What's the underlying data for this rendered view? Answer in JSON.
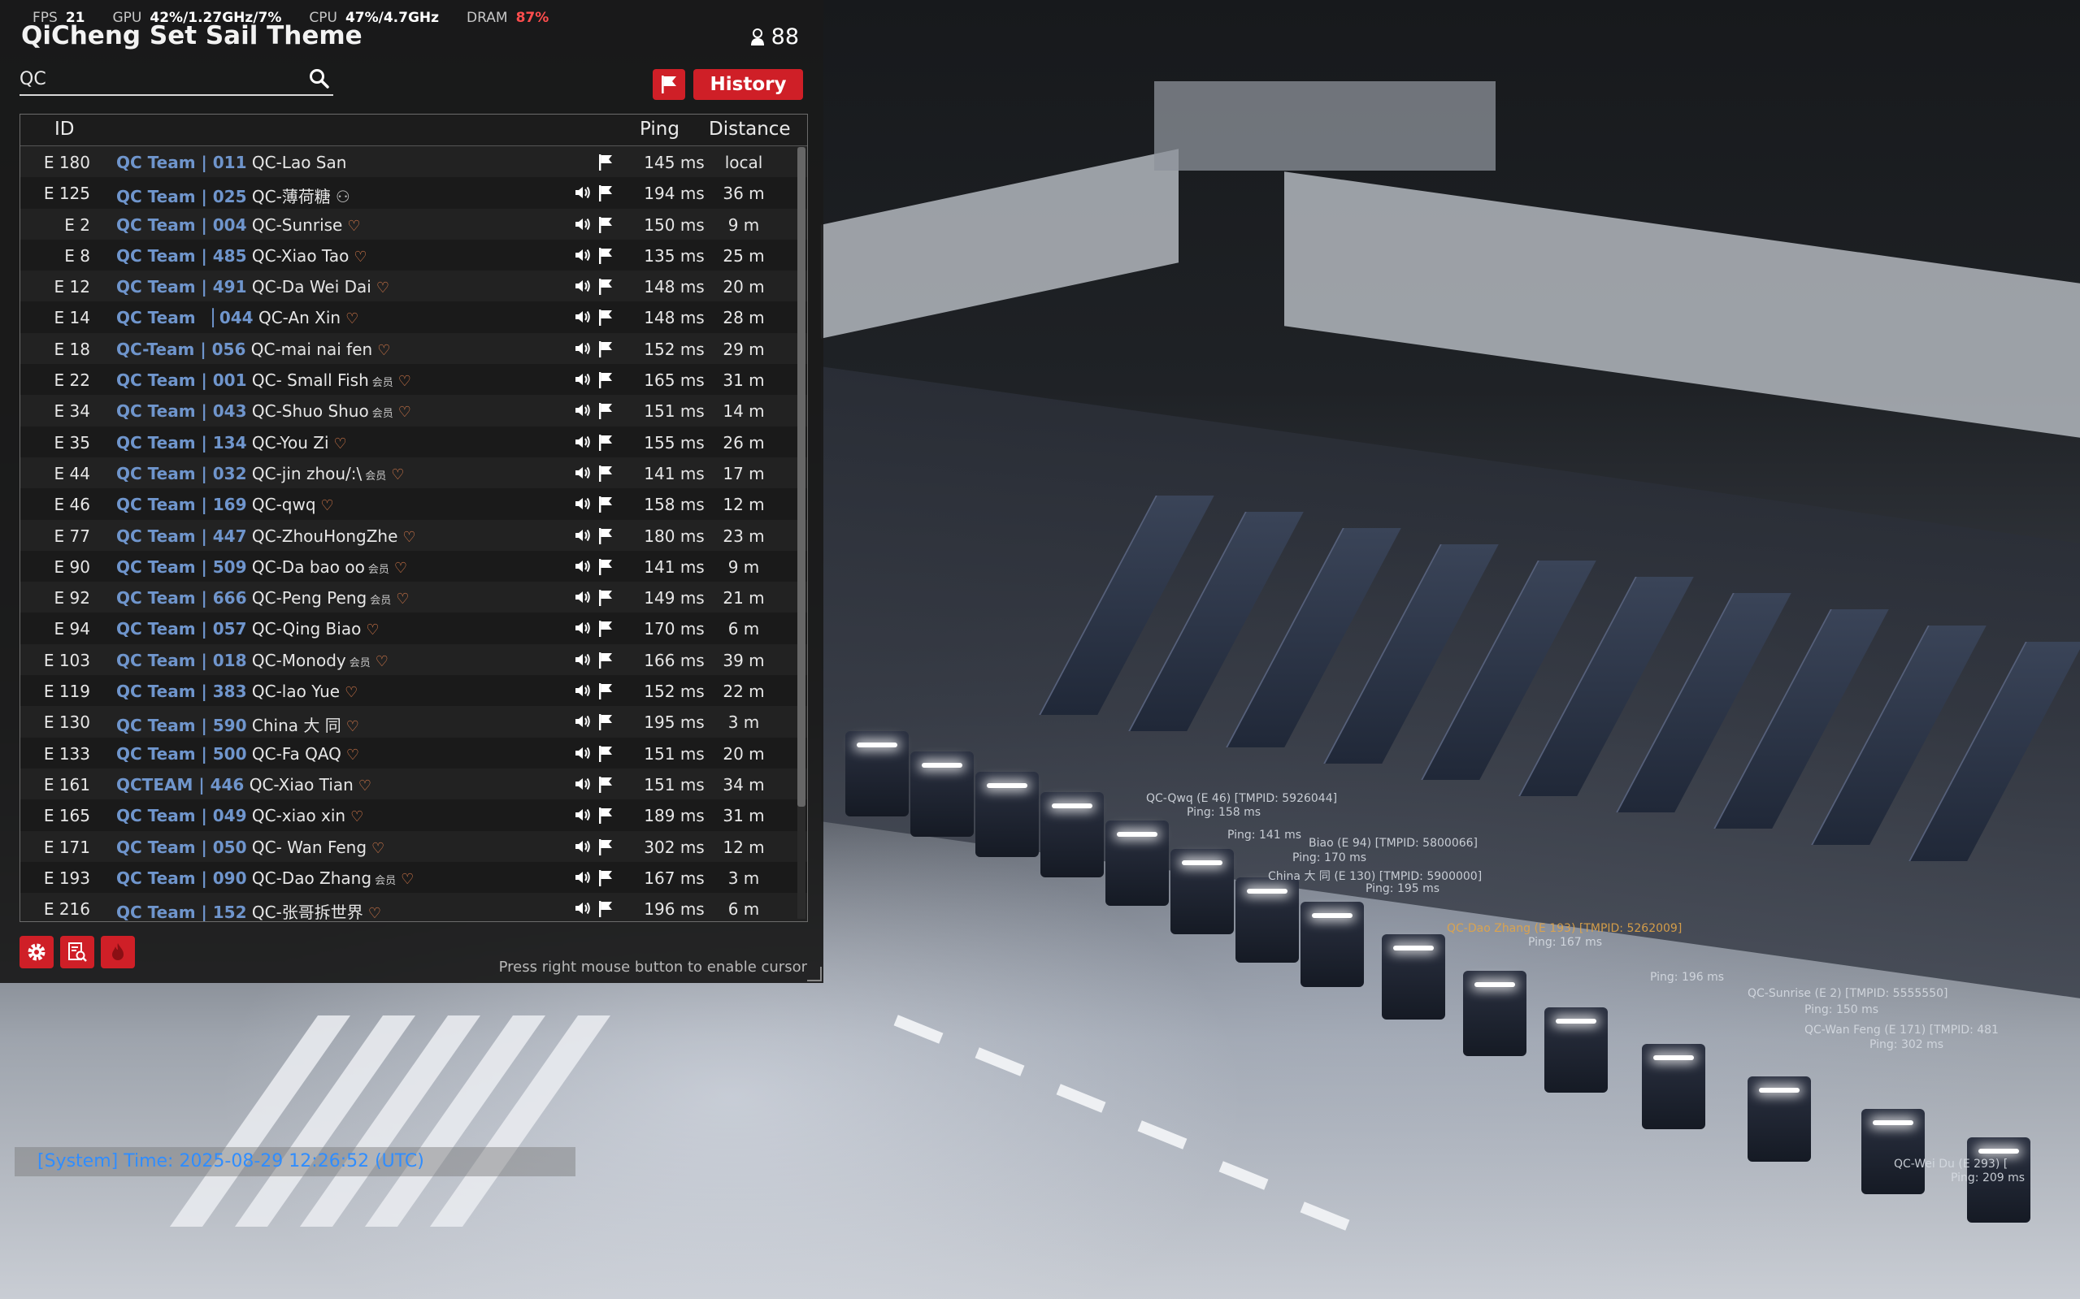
{
  "hud": {
    "fps_label": "FPS",
    "fps": "21",
    "gpu_label": "GPU",
    "gpu": "42%/1.27GHz/7%",
    "cpu_label": "CPU",
    "cpu": "47%/4.7GHz",
    "dram_label": "DRAM",
    "dram": "87%"
  },
  "panel": {
    "title": "QiCheng Set Sail Theme",
    "player_count": "88",
    "search_value": "QC",
    "history_label": "History",
    "hint": "Press right mouse button to enable cursor"
  },
  "table": {
    "headers": {
      "id": "ID",
      "ping": "Ping",
      "distance": "Distance"
    },
    "rows": [
      {
        "id": "E 180",
        "team": "QC Team | 011",
        "name": "QC-Lao San",
        "extra": "",
        "speaker": false,
        "ping": "145 ms",
        "dist": "local"
      },
      {
        "id": "E 125",
        "team": "QC Team | 025",
        "name": "QC-薄荷糖",
        "extra": "person",
        "speaker": true,
        "ping": "194 ms",
        "dist": "36 m"
      },
      {
        "id": "E 2",
        "team": "QC Team | 004",
        "name": "QC-Sunrise",
        "extra": "heart",
        "speaker": true,
        "ping": "150 ms",
        "dist": "9 m"
      },
      {
        "id": "E 8",
        "team": "QC Team | 485",
        "name": "QC-Xiao Tao",
        "extra": "heart",
        "speaker": true,
        "ping": "135 ms",
        "dist": "25 m"
      },
      {
        "id": "E 12",
        "team": "QC Team | 491",
        "name": "QC-Da Wei Dai",
        "extra": "heart",
        "speaker": true,
        "ping": "148 ms",
        "dist": "20 m"
      },
      {
        "id": "E 14",
        "team": "QC Team ▕ 044",
        "name": "QC-An Xin",
        "extra": "heart",
        "speaker": true,
        "ping": "148 ms",
        "dist": "28 m"
      },
      {
        "id": "E 18",
        "team": "QC-Team | 056",
        "name": "QC-mai nai fen",
        "extra": "heart",
        "speaker": true,
        "ping": "152 ms",
        "dist": "29 m"
      },
      {
        "id": "E 22",
        "team": "QC Team | 001",
        "name": "QC- Small Fish",
        "extra": "member-heart",
        "speaker": true,
        "ping": "165 ms",
        "dist": "31 m"
      },
      {
        "id": "E 34",
        "team": "QC Team | 043",
        "name": "QC-Shuo Shuo",
        "extra": "member-heart",
        "speaker": true,
        "ping": "151 ms",
        "dist": "14 m"
      },
      {
        "id": "E 35",
        "team": "QC Team | 134",
        "name": "QC-You Zi",
        "extra": "heart",
        "speaker": true,
        "ping": "155 ms",
        "dist": "26 m"
      },
      {
        "id": "E 44",
        "team": "QC Team | 032",
        "name": "QC-jin zhou/:\\",
        "extra": "member-heart",
        "speaker": true,
        "ping": "141 ms",
        "dist": "17 m"
      },
      {
        "id": "E 46",
        "team": "QC Team | 169",
        "name": "QC-qwq",
        "extra": "heart",
        "speaker": true,
        "ping": "158 ms",
        "dist": "12 m"
      },
      {
        "id": "E 77",
        "team": "QC Team | 447",
        "name": "QC-ZhouHongZhe",
        "extra": "heart",
        "speaker": true,
        "ping": "180 ms",
        "dist": "23 m"
      },
      {
        "id": "E 90",
        "team": "QC Team | 509",
        "name": "QC-Da bao oo",
        "extra": "member-heart",
        "speaker": true,
        "ping": "141 ms",
        "dist": "9 m"
      },
      {
        "id": "E 92",
        "team": "QC Team | 666",
        "name": " QC-Peng Peng",
        "extra": "member-heart",
        "speaker": true,
        "ping": "149 ms",
        "dist": "21 m"
      },
      {
        "id": "E 94",
        "team": "QC Team | 057",
        "name": "QC-Qing Biao",
        "extra": "heart",
        "speaker": true,
        "ping": "170 ms",
        "dist": "6 m"
      },
      {
        "id": "E 103",
        "team": "QC Team | 018",
        "name": "QC-Monody",
        "extra": "member-heart",
        "speaker": true,
        "ping": "166 ms",
        "dist": "39 m"
      },
      {
        "id": "E 119",
        "team": "QC Team | 383",
        "name": "QC-lao Yue",
        "extra": "heart",
        "speaker": true,
        "ping": "152 ms",
        "dist": "22 m"
      },
      {
        "id": "E 130",
        "team": "QC Team | 590",
        "name": "China 大 同",
        "extra": "heart",
        "speaker": true,
        "ping": "195 ms",
        "dist": "3 m"
      },
      {
        "id": "E 133",
        "team": "QC Team | 500",
        "name": "QC-Fa QAQ",
        "extra": "heart",
        "speaker": true,
        "ping": "151 ms",
        "dist": "20 m"
      },
      {
        "id": "E 161",
        "team": "QCTEAM | 446",
        "name": "QC-Xiao Tian",
        "extra": "heart",
        "speaker": true,
        "ping": "151 ms",
        "dist": "34 m"
      },
      {
        "id": "E 165",
        "team": "QC Team | 049",
        "name": "QC-xiao xin",
        "extra": "heart",
        "speaker": true,
        "ping": "189 ms",
        "dist": "31 m"
      },
      {
        "id": "E 171",
        "team": "QC Team | 050",
        "name": "QC- Wan Feng",
        "extra": "heart",
        "speaker": true,
        "ping": "302 ms",
        "dist": "12 m"
      },
      {
        "id": "E 193",
        "team": "QC Team | 090",
        "name": "QC-Dao Zhang",
        "extra": "member-heart",
        "speaker": true,
        "ping": "167 ms",
        "dist": "3 m"
      },
      {
        "id": "E 216",
        "team": "QC Team | 152",
        "name": "QC-张哥拆世界",
        "extra": "heart",
        "speaker": true,
        "ping": "196 ms",
        "dist": "6 m"
      }
    ],
    "member_badge": "会员"
  },
  "chat": {
    "message": "[System] Time: 2025-08-29 12:26:52 (UTC)"
  },
  "scene_tags": [
    "QC-Qwq (E 46) [TMPID: 5926044]",
    "QC-Dao Zhang (E 193) [TMPID: 5262009]",
    "QC-Sunrise (E 2) [TMPID: 5555550]",
    "Ping: 196 ms",
    "Ping: 150 ms",
    "Ping: 302 ms",
    "Ping: 209 ms",
    "QC-Wan Feng (E 171) [TMPID: 481",
    "QC-Wei Du (E 293) [",
    "Ping: 167 ms",
    "China 大 同 (E 130) [TMPID: 5900000]",
    "Ping: 195 ms",
    "Biao (E 94) [TMPID: 5800066]",
    "Ping: 170 ms",
    "Ping: 158 ms",
    "Ping: 141 ms"
  ],
  "colors": {
    "accent_red": "#cf1f27",
    "team_blue": "#6f95cc",
    "chat_blue": "#2f8dff",
    "dram_red": "#ff4d4d"
  }
}
